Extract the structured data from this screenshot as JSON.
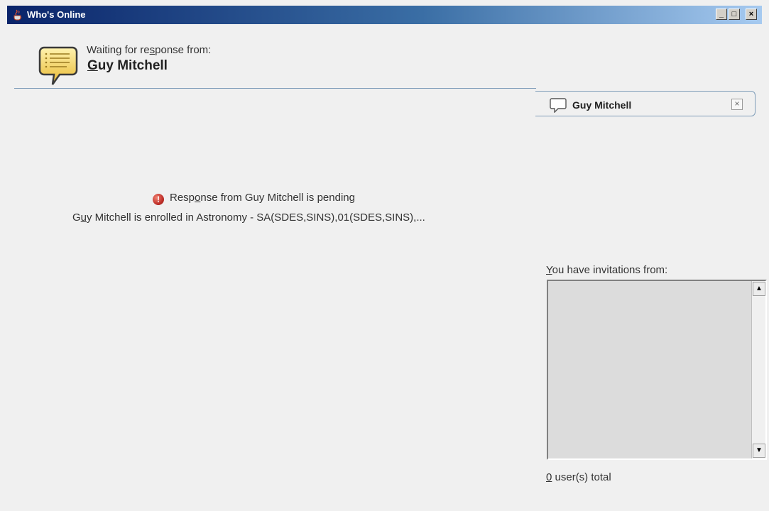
{
  "window": {
    "title": "Who's Online",
    "controls": {
      "minimize": "_",
      "maximize": "□",
      "close": "×"
    },
    "app_icon": "java-cup-icon"
  },
  "header": {
    "icon": "chat-bubble-icon",
    "waiting_label_pre": "Waiting for re",
    "waiting_label_mnemonic": "s",
    "waiting_label_post": "ponse from:",
    "contact_first_letter": "G",
    "contact_rest": "uy Mitchell"
  },
  "main": {
    "status_icon": "error-icon",
    "pending_pre": "Resp",
    "pending_mnemonic": "o",
    "pending_post": "nse from Guy Mitchell is pending",
    "enrolled_pre": "G",
    "enrolled_mnemonic": "u",
    "enrolled_post": "y Mitchell is enrolled in Astronomy - SA(SDES,SINS),01(SDES,SINS),..."
  },
  "tab": {
    "icon": "speech-bubble-icon",
    "label": "Guy Mitchell",
    "close": "×"
  },
  "invitations": {
    "label_mnemonic": "Y",
    "label_rest": "ou have invitations from:",
    "items": [],
    "total_count": "0",
    "total_suffix": " user(s) total"
  },
  "colors": {
    "titlebar_start": "#0a246a",
    "titlebar_end": "#a6caf0",
    "background": "#f0f0f0",
    "error_red": "#c0302a",
    "bubble_yellow": "#f2c94c"
  }
}
